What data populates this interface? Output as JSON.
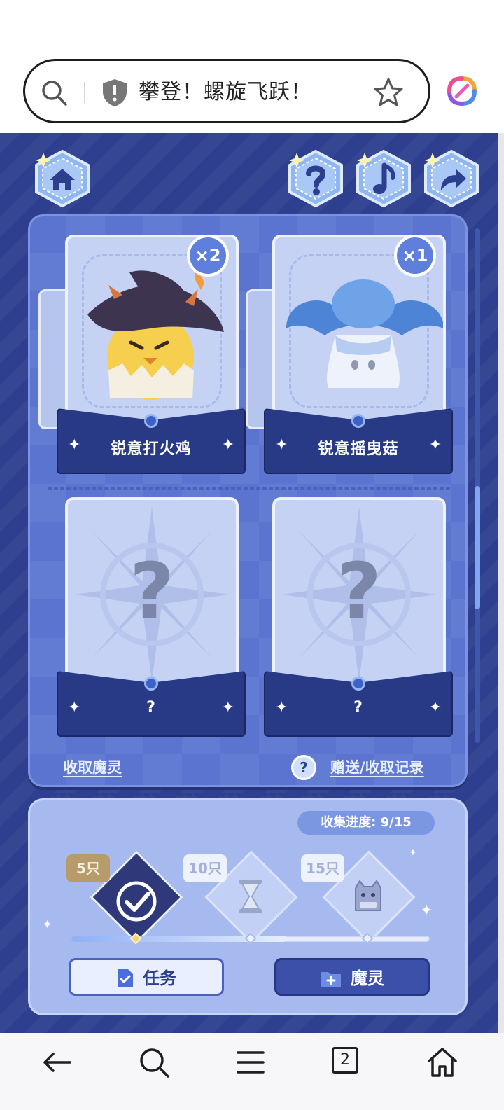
{
  "browser": {
    "address_title": "攀登！螺旋飞跃！",
    "tabs_count": "2"
  },
  "game": {
    "cards": [
      {
        "name": "锐意打火鸡",
        "count": "×2",
        "collected": true
      },
      {
        "name": "锐意摇曳菇",
        "count": "×1",
        "collected": true
      },
      {
        "name": "?",
        "count": "",
        "collected": false
      },
      {
        "name": "?",
        "count": "",
        "collected": false
      }
    ],
    "mystery_mark": "?",
    "collect_link": "收取魔灵",
    "help_mark": "?",
    "records_link": "赠送/收取记录",
    "progress": {
      "label": "收集进度: 9/15",
      "current": 9,
      "total": 15,
      "milestones": [
        {
          "tag": "5只",
          "reached": true
        },
        {
          "tag": "10只",
          "reached": false
        },
        {
          "tag": "15只",
          "reached": false
        }
      ]
    },
    "buttons": {
      "task": "任务",
      "spirit": "魔灵"
    }
  },
  "colors": {
    "game_bg": "#2d3f8e",
    "panel": "#5a74cf",
    "progress_panel": "#a7baf0",
    "accent": "#7ea6f2"
  }
}
